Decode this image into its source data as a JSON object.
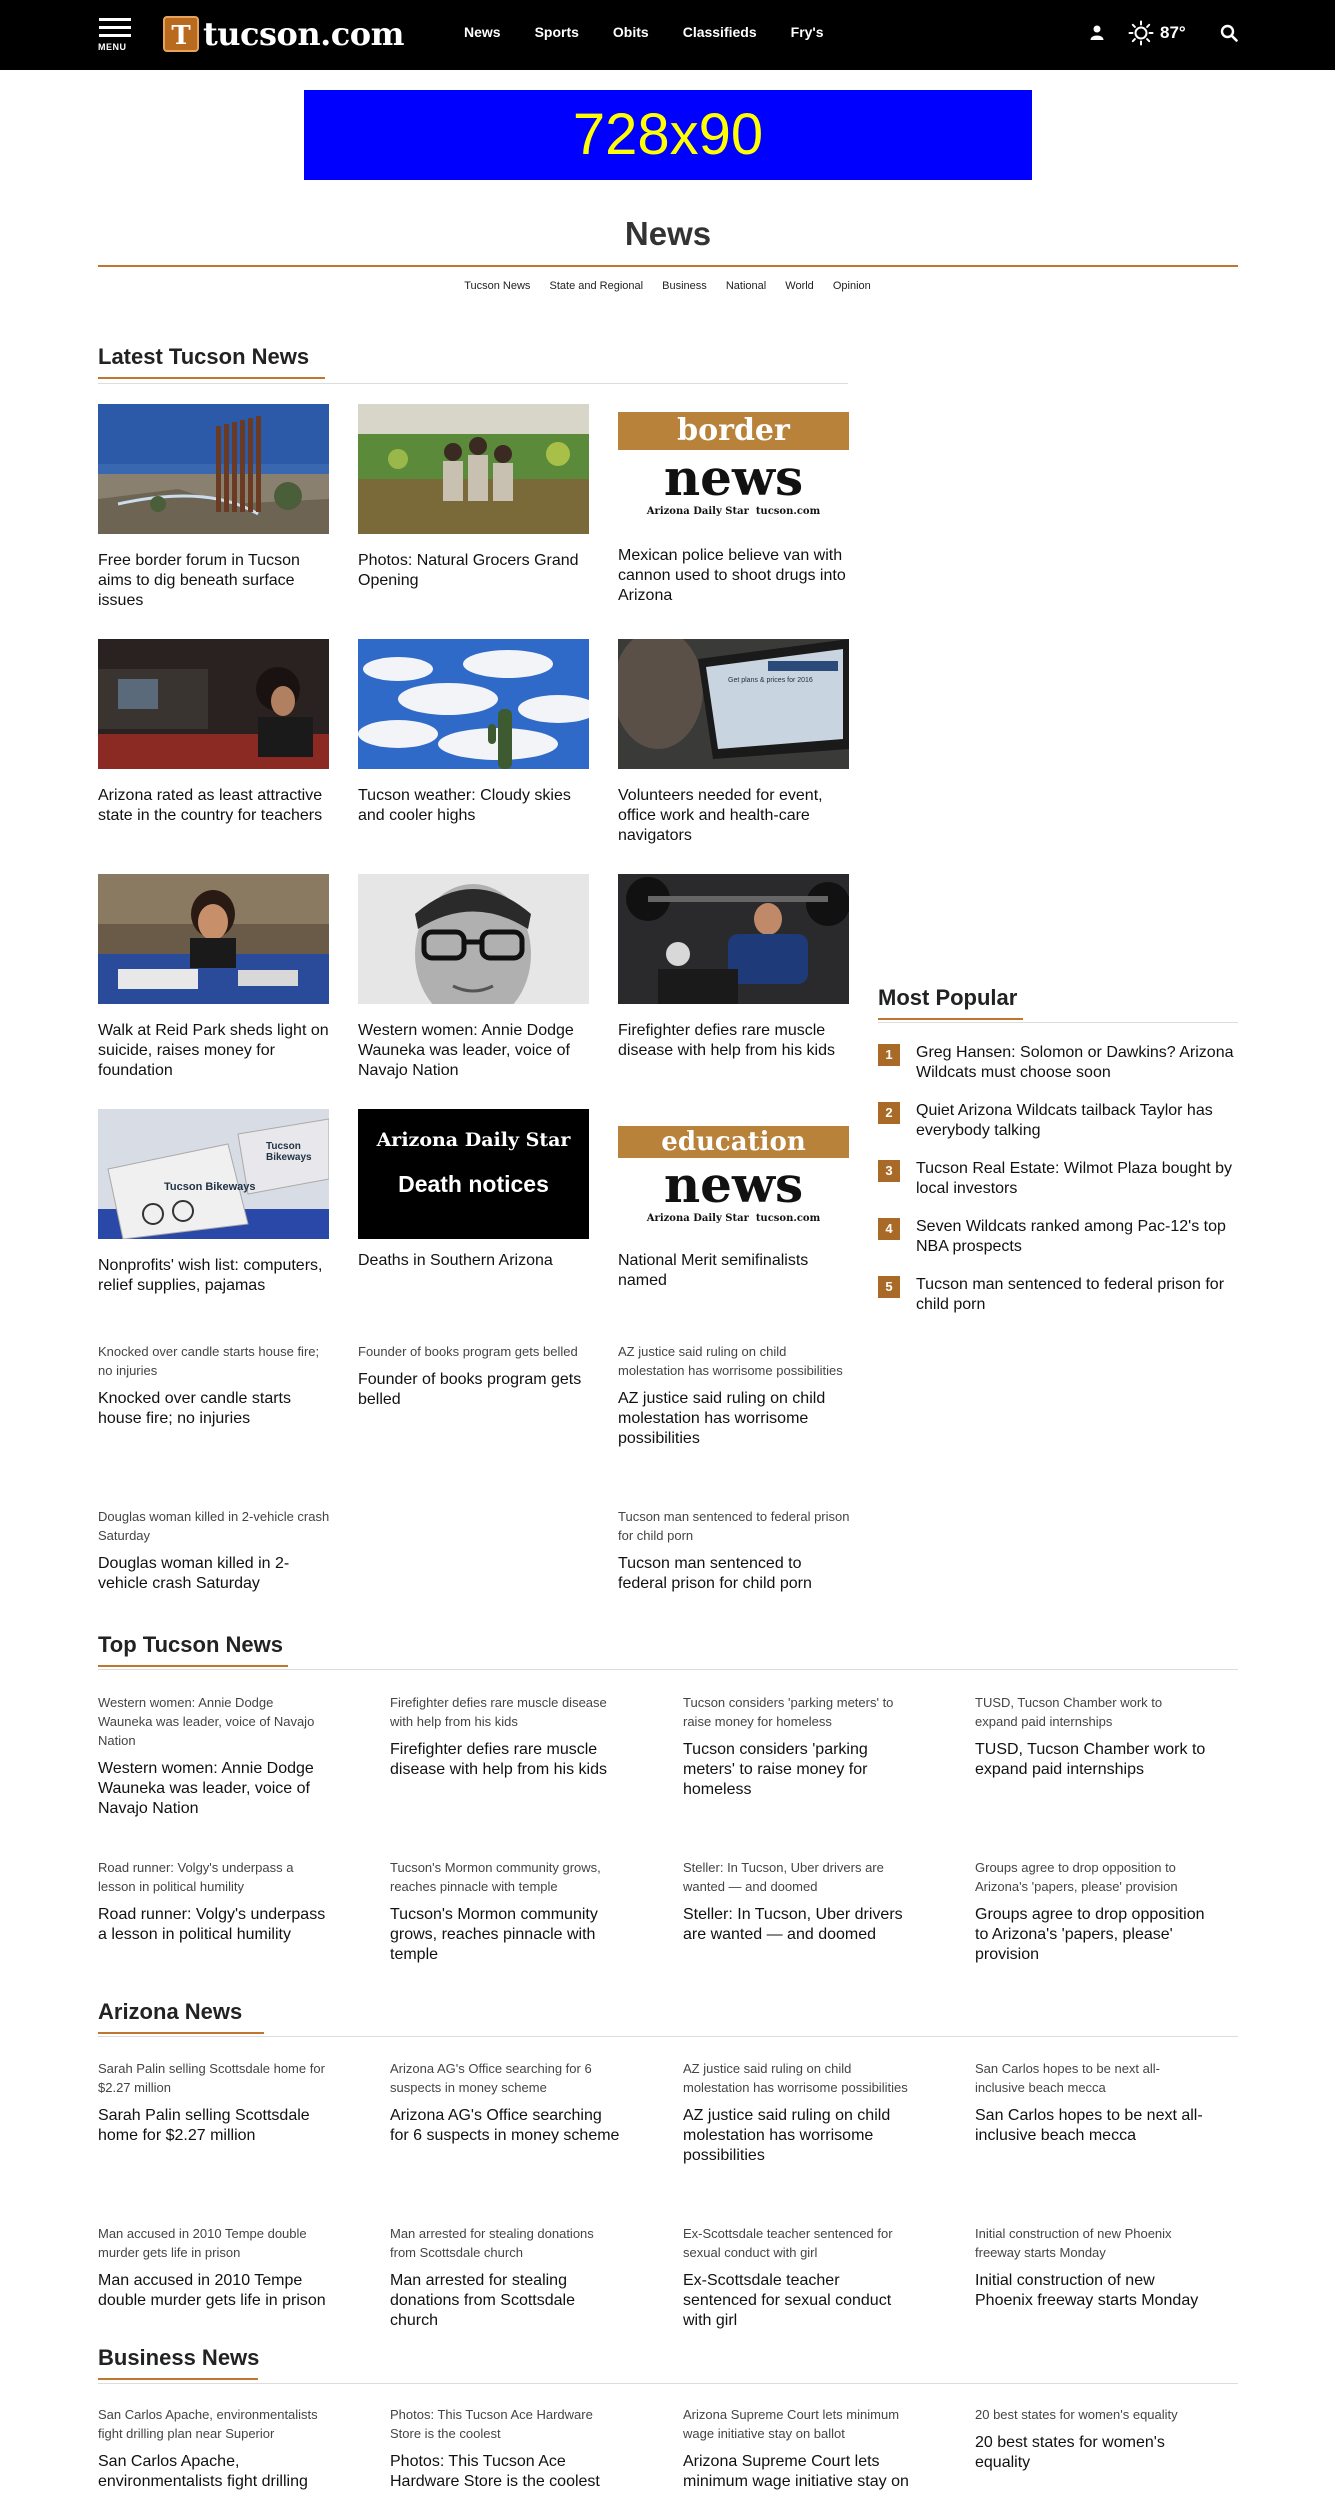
{
  "header": {
    "menu_label": "MENU",
    "logo_letter": "T",
    "logo_text": "tucson.com",
    "nav": [
      "News",
      "Sports",
      "Obits",
      "Classifieds",
      "Fry's"
    ],
    "weather_temp": "87°"
  },
  "ad": {
    "label": "728x90"
  },
  "page": {
    "title": "News",
    "subnav": [
      "Tucson News",
      "State and Regional",
      "Business",
      "National",
      "World",
      "Opinion"
    ]
  },
  "latest": {
    "heading": "Latest Tucson News",
    "cards": [
      {
        "headline": "Free border forum in Tucson aims to dig beneath surface issues"
      },
      {
        "headline": "Photos: Natural Grocers Grand Opening"
      },
      {
        "headline": "Mexican police believe van with cannon used to shoot drugs into Arizona",
        "img_top": "border",
        "img_bottom": "news",
        "img_brand1": "Arizona Daily Star",
        "img_brand2": "tucson.com"
      },
      {
        "headline": "Arizona rated as least attractive state in the country for teachers"
      },
      {
        "headline": "Tucson weather: Cloudy skies and cooler highs"
      },
      {
        "headline": "Volunteers needed for event, office work and health-care navigators",
        "img_screen_text": "Get plans & prices for 2016"
      },
      {
        "headline": "Walk at Reid Park sheds light on suicide, raises money for foundation"
      },
      {
        "headline": "Western women: Annie Dodge Wauneka was leader, voice of Navajo Nation"
      },
      {
        "headline": "Firefighter defies rare muscle disease with help from his kids"
      },
      {
        "headline": "Nonprofits' wish list: computers, relief supplies, pajamas",
        "img_sign": "Tucson Bikeways"
      },
      {
        "headline": "Deaths in Southern Arizona",
        "img_top": "Arizona Daily Star",
        "img_bottom": "Death notices"
      },
      {
        "headline": "National Merit semifinalists named",
        "img_top": "education",
        "img_bottom": "news",
        "img_brand1": "Arizona Daily Star",
        "img_brand2": "tucson.com"
      }
    ],
    "text_items": [
      {
        "kicker": "Knocked over candle starts house fire; no injuries",
        "headline": "Knocked over candle starts house fire; no injuries"
      },
      {
        "kicker": "Founder of books program gets belled",
        "headline": "Founder of books program gets belled"
      },
      {
        "kicker": "AZ justice said ruling on child molestation has worrisome possibilities",
        "headline": "AZ justice said ruling on child molestation has worrisome possibilities"
      },
      {
        "kicker": "Douglas woman killed in 2-vehicle crash Saturday",
        "headline": "Douglas woman killed in 2-vehicle crash Saturday"
      },
      {
        "kicker": "Tucson man sentenced to federal prison for child porn",
        "headline": "Tucson man sentenced to federal prison for child porn"
      }
    ]
  },
  "popular": {
    "heading": "Most Popular",
    "items": [
      {
        "num": "1",
        "text": "Greg Hansen: Solomon or Dawkins? Arizona Wildcats must choose soon"
      },
      {
        "num": "2",
        "text": "Quiet Arizona Wildcats tailback Taylor has everybody talking"
      },
      {
        "num": "3",
        "text": "Tucson Real Estate: Wilmot Plaza bought by local investors"
      },
      {
        "num": "4",
        "text": "Seven Wildcats ranked among Pac-12's top NBA prospects"
      },
      {
        "num": "5",
        "text": "Tucson man sentenced to federal prison for child porn"
      }
    ]
  },
  "top_tucson": {
    "heading": "Top Tucson News",
    "items": [
      {
        "kicker": "Western women: Annie Dodge Wauneka was leader, voice of Navajo Nation",
        "headline": "Western women: Annie Dodge Wauneka was leader, voice of Navajo Nation"
      },
      {
        "kicker": "Firefighter defies rare muscle disease with help from his kids",
        "headline": "Firefighter defies rare muscle disease with help from his kids"
      },
      {
        "kicker": "Tucson considers 'parking meters' to raise money for homeless",
        "headline": "Tucson considers 'parking meters' to raise money for homeless"
      },
      {
        "kicker": "TUSD, Tucson Chamber work to expand paid internships",
        "headline": "TUSD, Tucson Chamber work to expand paid internships"
      },
      {
        "kicker": "Road runner: Volgy's underpass a lesson in political humility",
        "headline": "Road runner: Volgy's underpass a lesson in political humility"
      },
      {
        "kicker": "Tucson's Mormon community grows, reaches pinnacle with temple",
        "headline": "Tucson's Mormon community grows, reaches pinnacle with temple"
      },
      {
        "kicker": "Steller: In Tucson, Uber drivers are wanted — and doomed",
        "headline": "Steller: In Tucson, Uber drivers are wanted — and doomed"
      },
      {
        "kicker": "Groups agree to drop opposition to Arizona's 'papers, please' provision",
        "headline": "Groups agree to drop opposition to Arizona's 'papers, please' provision"
      }
    ]
  },
  "arizona": {
    "heading": "Arizona News",
    "items": [
      {
        "kicker": "Sarah Palin selling Scottsdale home for $2.27 million",
        "headline": "Sarah Palin selling Scottsdale home for $2.27 million"
      },
      {
        "kicker": "Arizona AG's Office searching for 6 suspects in money scheme",
        "headline": "Arizona AG's Office searching for 6 suspects in money scheme"
      },
      {
        "kicker": "AZ justice said ruling on child molestation has worrisome possibilities",
        "headline": "AZ justice said ruling on child molestation has worrisome possibilities"
      },
      {
        "kicker": "San Carlos hopes to be next all-inclusive beach mecca",
        "headline": "San Carlos hopes to be next all-inclusive beach mecca"
      },
      {
        "kicker": "Man accused in 2010 Tempe double murder gets life in prison",
        "headline": "Man accused in 2010 Tempe double murder gets life in prison"
      },
      {
        "kicker": "Man arrested for stealing donations from Scottsdale church",
        "headline": "Man arrested for stealing donations from Scottsdale church"
      },
      {
        "kicker": "Ex-Scottsdale teacher sentenced for sexual conduct with girl",
        "headline": "Ex-Scottsdale teacher sentenced for sexual conduct with girl"
      },
      {
        "kicker": "Initial construction of new Phoenix freeway starts Monday",
        "headline": "Initial construction of new Phoenix freeway starts Monday"
      }
    ]
  },
  "business": {
    "heading": "Business News",
    "items": [
      {
        "kicker": "San Carlos Apache, environmentalists fight drilling plan near Superior",
        "headline": "San Carlos Apache, environmentalists fight drilling"
      },
      {
        "kicker": "Photos: This Tucson Ace Hardware Store is the coolest",
        "headline": "Photos: This Tucson Ace Hardware Store is the coolest"
      },
      {
        "kicker": "Arizona Supreme Court lets minimum wage initiative stay on ballot",
        "headline": "Arizona Supreme Court lets minimum wage initiative stay on"
      },
      {
        "kicker": "20 best states for women's equality",
        "headline": "20 best states for women's equality"
      }
    ]
  },
  "colors": {
    "accent": "#c0762e",
    "ad_bg": "#0000ff",
    "ad_text": "#ffff00",
    "header_bg": "#000000"
  },
  "icons": [
    "menu-icon",
    "user-icon",
    "sun-icon",
    "search-icon"
  ]
}
